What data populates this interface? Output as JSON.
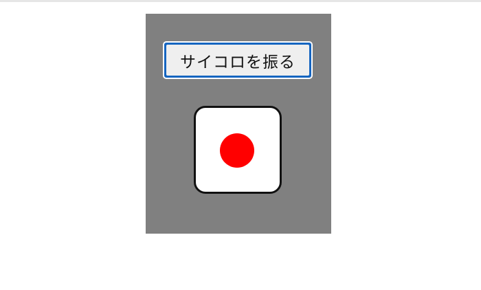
{
  "roll_button": {
    "label": "サイコロを振る"
  },
  "die": {
    "face_value": 1,
    "pip_color": "#ff0000"
  },
  "colors": {
    "panel_background": "#808080",
    "button_border": "#1565c0",
    "die_face": "#ffffff"
  }
}
